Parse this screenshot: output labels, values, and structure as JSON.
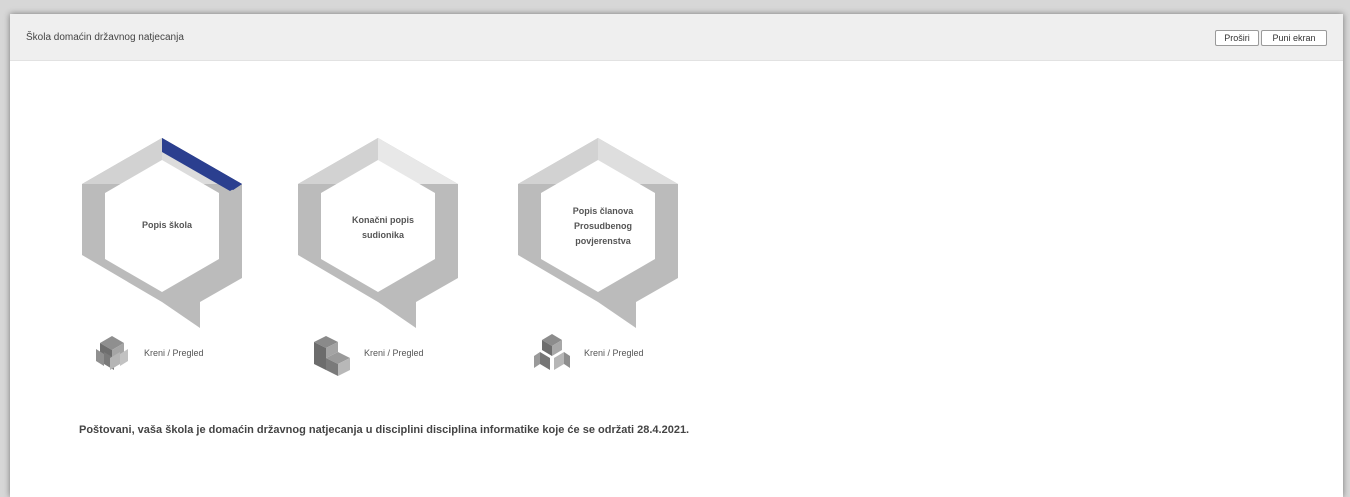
{
  "window": {
    "title": "Škola domaćin državnog natjecanja",
    "expand_label": "Proširi",
    "fullscreen_label": "Puni ekran"
  },
  "tiles": [
    {
      "label_lines": [
        "Popis škola"
      ],
      "link_label": "Kreni / Pregled",
      "icon": "cube-stack-icon"
    },
    {
      "label_lines": [
        "Konačni popis",
        "sudionika"
      ],
      "link_label": "Kreni / Pregled",
      "icon": "cube-stair-icon"
    },
    {
      "label_lines": [
        "Popis članova",
        "Prosudbenog",
        "povjerenstva"
      ],
      "link_label": "Kreni / Pregled",
      "icon": "cube-cluster-icon"
    }
  ],
  "notice": "Poštovani, vaša škola je domaćin državnog natjecanja u disciplini disciplina informatike koje će se održati 28.4.2021.",
  "colors": {
    "accent": "#2b3f8f",
    "hex_gray": "#bbbbbb",
    "hex_light": "#e8e8e8"
  }
}
